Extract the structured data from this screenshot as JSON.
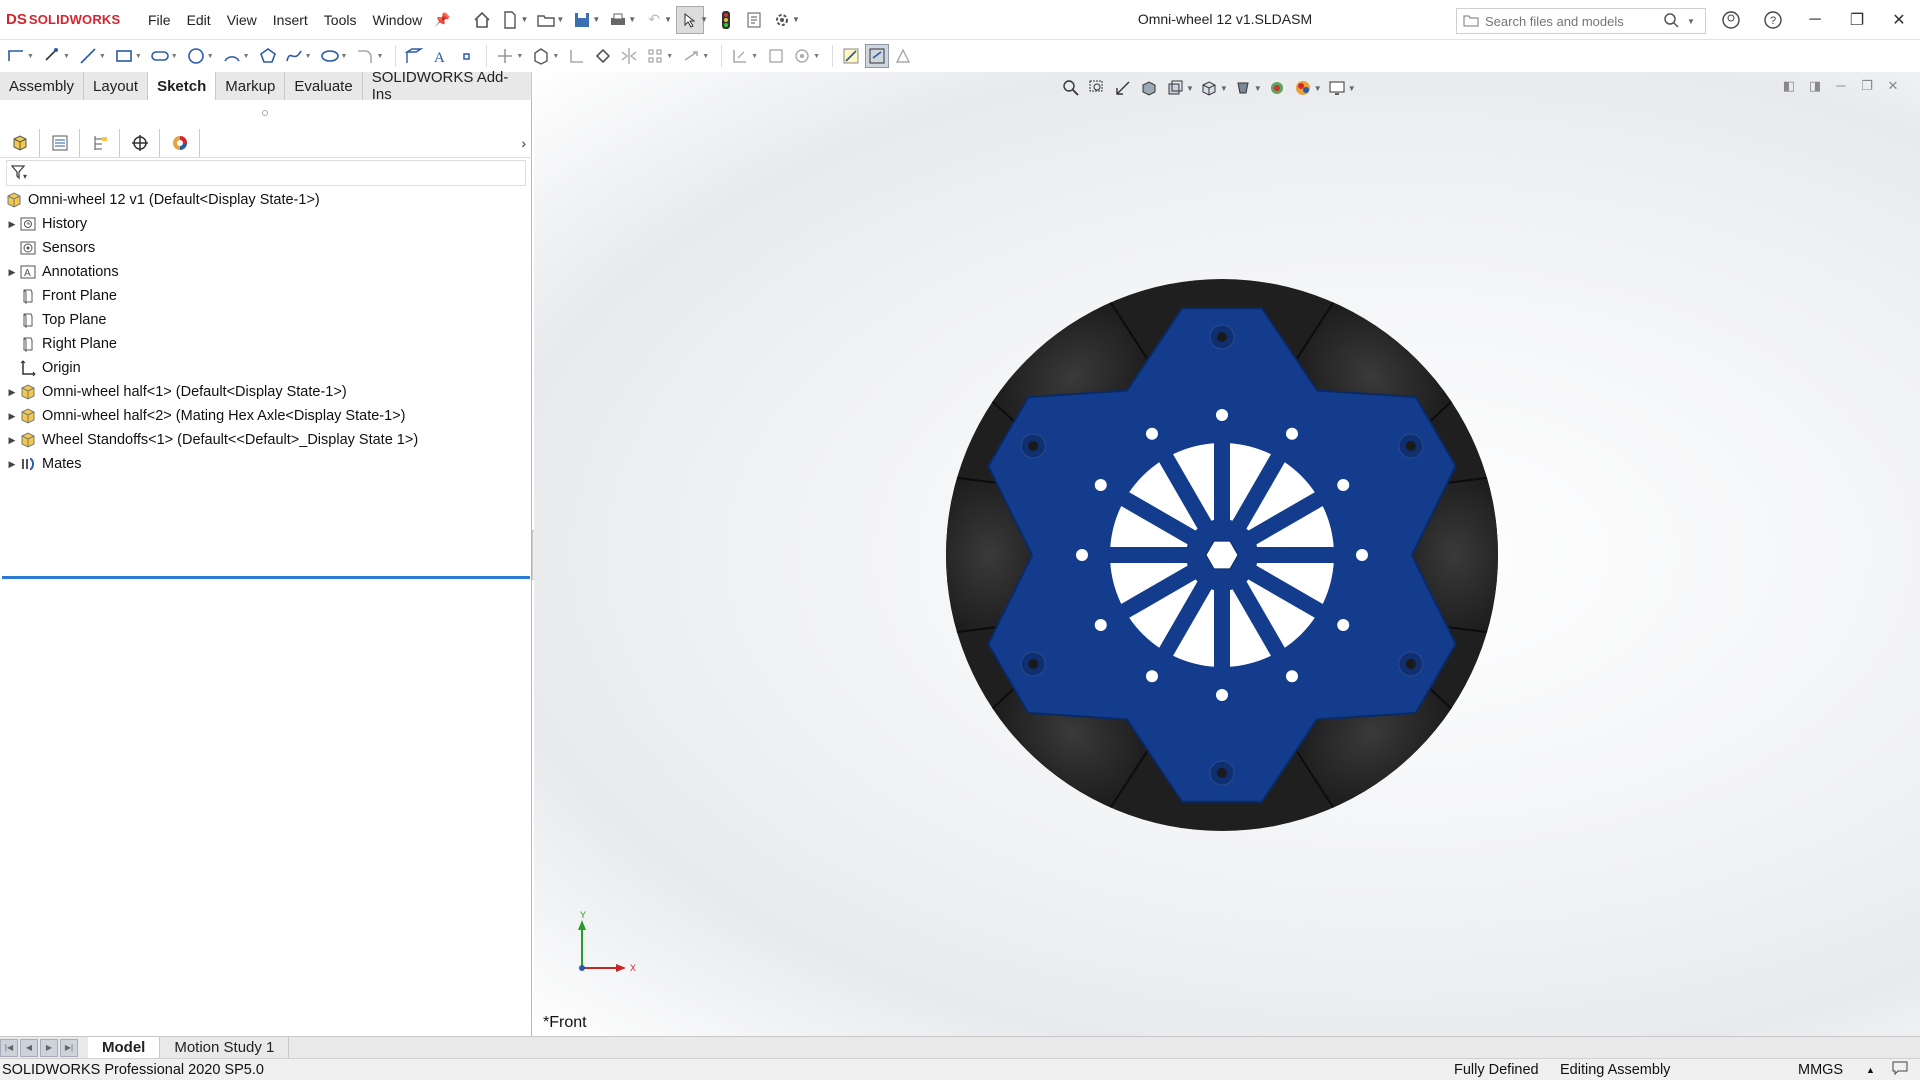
{
  "app": {
    "logo_mark": "DS",
    "logo_text": "SOLIDWORKS",
    "document_title": "Omni-wheel 12 v1.SLDASM"
  },
  "menu": [
    "File",
    "Edit",
    "View",
    "Insert",
    "Tools",
    "Window"
  ],
  "search": {
    "placeholder": "Search files and models"
  },
  "tabs": [
    {
      "label": "Assembly",
      "active": false
    },
    {
      "label": "Layout",
      "active": false
    },
    {
      "label": "Sketch",
      "active": true
    },
    {
      "label": "Markup",
      "active": false
    },
    {
      "label": "Evaluate",
      "active": false
    },
    {
      "label": "SOLIDWORKS Add-Ins",
      "active": false
    }
  ],
  "tree": {
    "root": "Omni-wheel 12 v1  (Default<Display State-1>)",
    "items": [
      {
        "label": "History",
        "icon": "history-icon",
        "expandable": true
      },
      {
        "label": "Sensors",
        "icon": "sensors-icon",
        "expandable": false
      },
      {
        "label": "Annotations",
        "icon": "annotations-icon",
        "expandable": true
      },
      {
        "label": "Front Plane",
        "icon": "plane-icon",
        "expandable": false
      },
      {
        "label": "Top Plane",
        "icon": "plane-icon",
        "expandable": false
      },
      {
        "label": "Right Plane",
        "icon": "plane-icon",
        "expandable": false
      },
      {
        "label": "Origin",
        "icon": "origin-icon",
        "expandable": false
      },
      {
        "label": "Omni-wheel half<1> (Default<Display State-1>)",
        "icon": "part-icon",
        "expandable": true
      },
      {
        "label": "Omni-wheel half<2> (Mating Hex Axle<Display State-1>)",
        "icon": "part-icon",
        "expandable": true
      },
      {
        "label": "Wheel Standoffs<1> (Default<<Default>_Display State 1>)",
        "icon": "part-icon",
        "expandable": true
      },
      {
        "label": "Mates",
        "icon": "mates-icon",
        "expandable": true
      }
    ]
  },
  "viewport": {
    "view_name": "*Front",
    "triad_y": "Y",
    "triad_x": "X"
  },
  "bottom_tabs": [
    {
      "label": "Model",
      "active": true
    },
    {
      "label": "Motion Study 1",
      "active": false
    }
  ],
  "status": {
    "product": "SOLIDWORKS Professional 2020 SP5.0",
    "sketch_state": "Fully Defined",
    "mode": "Editing Assembly",
    "units": "MMGS"
  },
  "colors": {
    "brand": "#d6252e",
    "wheel_plate": "#143c8c",
    "roller": "#1e1e1e",
    "selection_line": "#2b7bd6"
  }
}
